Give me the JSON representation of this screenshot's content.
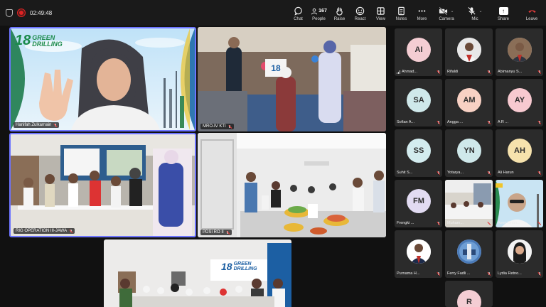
{
  "meeting": {
    "timer": "02:49:48"
  },
  "toolbar": {
    "chat": "Chat",
    "people": "People",
    "people_count": "167",
    "raise": "Raise",
    "react": "React",
    "view": "View",
    "notes": "Notes",
    "more": "More",
    "camera": "Camera",
    "mic": "Mic",
    "share": "Share",
    "leave": "Leave"
  },
  "tiles": [
    {
      "name": "Hanifah Zulkarnain",
      "banner_top": "18",
      "banner_text": "GREEN DRILLING"
    },
    {
      "name": "MRO-IV KTI"
    },
    {
      "name": "RIG OPERATION III-JAWA"
    },
    {
      "name": "PDSI RO II"
    },
    {
      "name": "",
      "banner_text": "GREEN DRILLING",
      "banner_top": "18"
    }
  ],
  "gallery": [
    {
      "initials": "AI",
      "name": "Ahmad..."
    },
    {
      "initials": "",
      "name": "Rifaldi"
    },
    {
      "initials": "",
      "name": "Abimanyu S..."
    },
    {
      "initials": "SA",
      "name": "Sofian A..."
    },
    {
      "initials": "AM",
      "name": "Angga ..."
    },
    {
      "initials": "AY",
      "name": "A R ..."
    },
    {
      "initials": "SS",
      "name": "Suhit S..."
    },
    {
      "initials": "YN",
      "name": "Yotarya..."
    },
    {
      "initials": "AH",
      "name": "Ali Harun"
    },
    {
      "initials": "FM",
      "name": "Frengki ..."
    },
    {
      "initials": "",
      "name": "Muham..."
    },
    {
      "initials": "",
      "name": "Avep Drian..."
    },
    {
      "initials": "",
      "name": "Purnama H..."
    },
    {
      "initials": "",
      "name": "Ferry Fadli ..."
    },
    {
      "initials": "",
      "name": "Lydia Retno..."
    },
    {
      "initials": "R",
      "name": ""
    }
  ],
  "colors": {
    "accent_border": "#6d74ff",
    "record": "#e02424",
    "leave": "#e23b3b",
    "avatar_pink": "#f4cdd3",
    "avatar_teal": "#cfe8ea",
    "avatar_peach": "#f8d1c4",
    "avatar_rose": "#f7c9d0",
    "avatar_cyan": "#d3ecef",
    "avatar_yellow": "#f6e2ad",
    "avatar_lavender": "#e2dbf2"
  }
}
